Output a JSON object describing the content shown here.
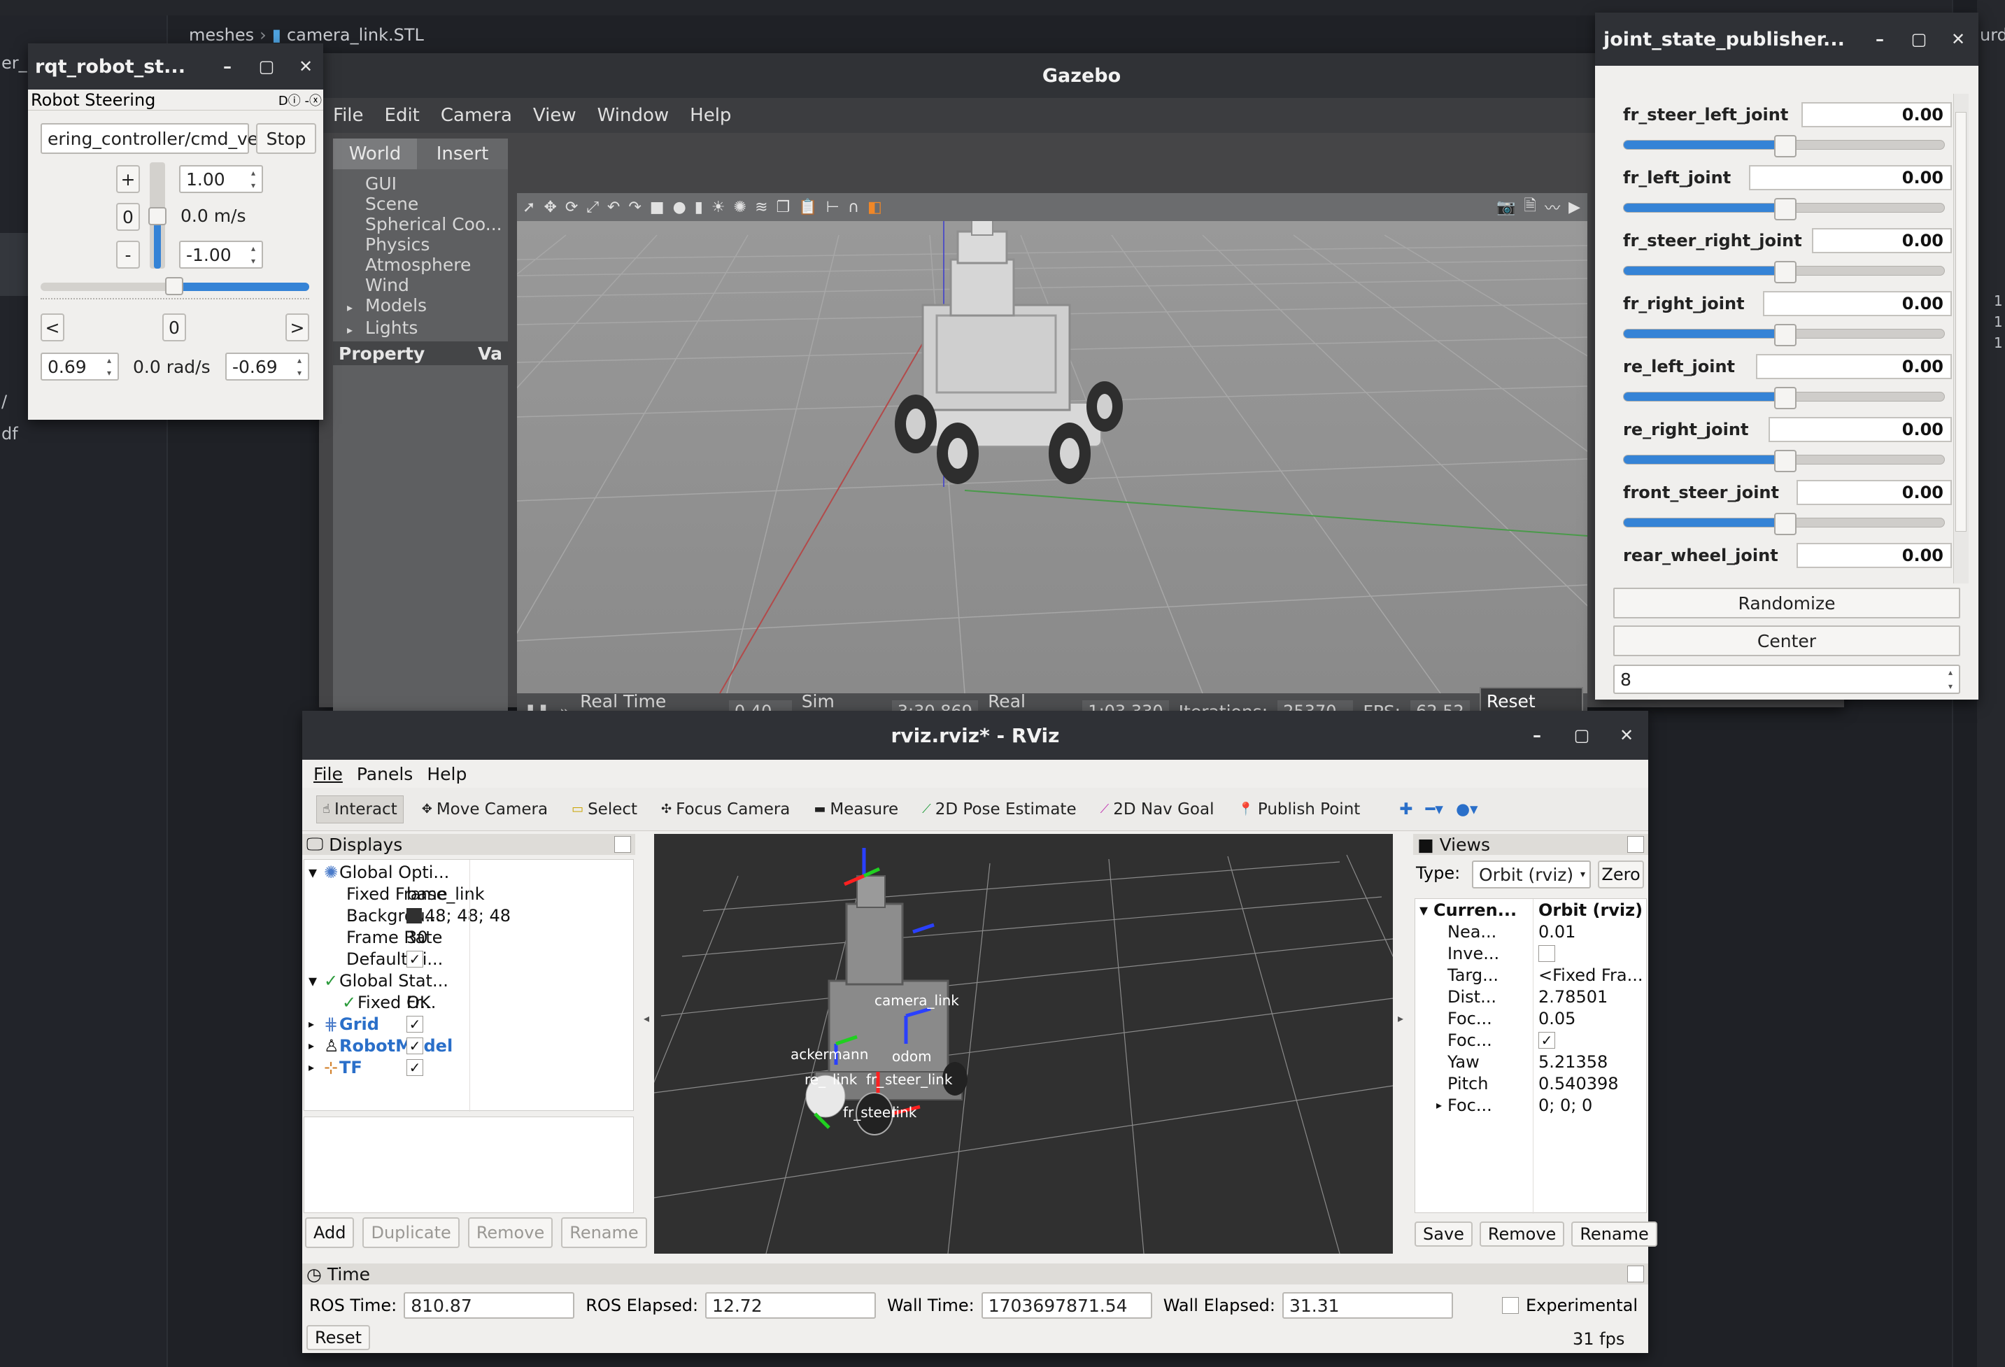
{
  "bg_editor": {
    "breadcrumb_folder": "meshes",
    "breadcrumb_file": "camera_link.STL",
    "frag_left_1": "er_S",
    "frag_left_2": "/",
    "frag_left_3": "df",
    "frag_right_1": "urd",
    "frag_right_2": "1",
    "frag_right_3": "1",
    "frag_right_4": "1"
  },
  "rqt": {
    "title": "rqt_robot_st...",
    "plugin_title": "Robot Steering",
    "plugin_ctrls": "Dⓘ -ⓧ",
    "topic": "ering_controller/cmd_vel",
    "stop_label": "Stop",
    "plus_label": "+",
    "zero_label": "0",
    "minus_label": "-",
    "max_linear": "1.00",
    "linear_value": "0.0 m/s",
    "min_linear": "-1.00",
    "left_label": "<",
    "center_label": "0",
    "right_label": ">",
    "max_angular": "0.69",
    "angular_value": "0.0 rad/s",
    "min_angular": "-0.69"
  },
  "gazebo": {
    "title": "Gazebo",
    "menu": [
      "File",
      "Edit",
      "Camera",
      "View",
      "Window",
      "Help"
    ],
    "tabs": [
      "World",
      "Insert"
    ],
    "tree": [
      "GUI",
      "Scene",
      "Spherical Coo...",
      "Physics",
      "Atmosphere",
      "Models",
      "Lights"
    ],
    "property_label": "Property",
    "value_label": "Va",
    "status": {
      "pause_icon": "pause-icon",
      "rtf_label": "Real Time Factor:",
      "rtf": "0.40",
      "sim_label": "Sim Time:",
      "sim": "3:30.869",
      "real_label": "Real Time:",
      "real": "1:03.330",
      "iter_label": "Iterations:",
      "iter": "25370",
      "fps_label": "FPS:",
      "fps": "62.52",
      "reset_label": "Reset Time"
    }
  },
  "jsp": {
    "title": "joint_state_publisher...",
    "joints": [
      {
        "name": "fr_steer_left_joint",
        "value": "0.00",
        "fraction": 0.5
      },
      {
        "name": "fr_left_joint",
        "value": "0.00",
        "fraction": 0.5
      },
      {
        "name": "fr_steer_right_joint",
        "value": "0.00",
        "fraction": 0.5
      },
      {
        "name": "fr_right_joint",
        "value": "0.00",
        "fraction": 0.5
      },
      {
        "name": "re_left_joint",
        "value": "0.00",
        "fraction": 0.5
      },
      {
        "name": "re_right_joint",
        "value": "0.00",
        "fraction": 0.5
      },
      {
        "name": "front_steer_joint",
        "value": "0.00",
        "fraction": 0.5
      },
      {
        "name": "rear_wheel_joint",
        "value": "0.00",
        "fraction": 0.5
      }
    ],
    "randomize_label": "Randomize",
    "center_label": "Center",
    "spin_value": "8"
  },
  "rviz": {
    "title": "rviz.rviz* - RViz",
    "menu": [
      "File",
      "Panels",
      "Help"
    ],
    "tools": [
      "Interact",
      "Move Camera",
      "Select",
      "Focus Camera",
      "Measure",
      "2D Pose Estimate",
      "2D Nav Goal",
      "Publish Point"
    ],
    "displays_title": "Displays",
    "displays": {
      "global_options": "Global Opti...",
      "fixed_frame_label": "Fixed Frame",
      "fixed_frame_value": "base_link",
      "background_label": "Backgrou...",
      "background_value": "48; 48; 48",
      "frame_rate_label": "Frame Rate",
      "frame_rate_value": "30",
      "default_light_label": "Default Li...",
      "global_status": "Global Stat...",
      "fixed_fr_status_label": "Fixed Fr...",
      "fixed_fr_status_value": "OK",
      "grid": "Grid",
      "robot_model": "RobotModel",
      "tf": "TF"
    },
    "display_buttons": [
      "Add",
      "Duplicate",
      "Remove",
      "Rename"
    ],
    "views_title": "Views",
    "views_type_label": "Type:",
    "views_type_value": "Orbit (rviz)",
    "views_zero_label": "Zero",
    "views_rows": [
      {
        "k": "Curren...",
        "v": "Orbit (rviz)"
      },
      {
        "k": "Nea...",
        "v": "0.01"
      },
      {
        "k": "Inve...",
        "v": ""
      },
      {
        "k": "Targ...",
        "v": "<Fixed Fra..."
      },
      {
        "k": "Dist...",
        "v": "2.78501"
      },
      {
        "k": "Foc...",
        "v": "0.05"
      },
      {
        "k": "Foc...",
        "v": ""
      },
      {
        "k": "Yaw",
        "v": "5.21358"
      },
      {
        "k": "Pitch",
        "v": "0.540398"
      },
      {
        "k": "Foc...",
        "v": "0; 0; 0"
      }
    ],
    "views_buttons": [
      "Save",
      "Remove",
      "Rename"
    ],
    "tf_labels": [
      "camera_link",
      "ackermann",
      "odom",
      "re_",
      "link",
      "fr_",
      "steer_link",
      "fr_steer",
      "link"
    ],
    "time_title": "Time",
    "ros_time_label": "ROS Time:",
    "ros_time": "810.87",
    "ros_elapsed_label": "ROS Elapsed:",
    "ros_elapsed": "12.72",
    "wall_time_label": "Wall Time:",
    "wall_time": "1703697871.54",
    "wall_elapsed_label": "Wall Elapsed:",
    "wall_elapsed": "31.31",
    "experimental_label": "Experimental",
    "reset_label": "Reset",
    "fps": "31 fps"
  }
}
